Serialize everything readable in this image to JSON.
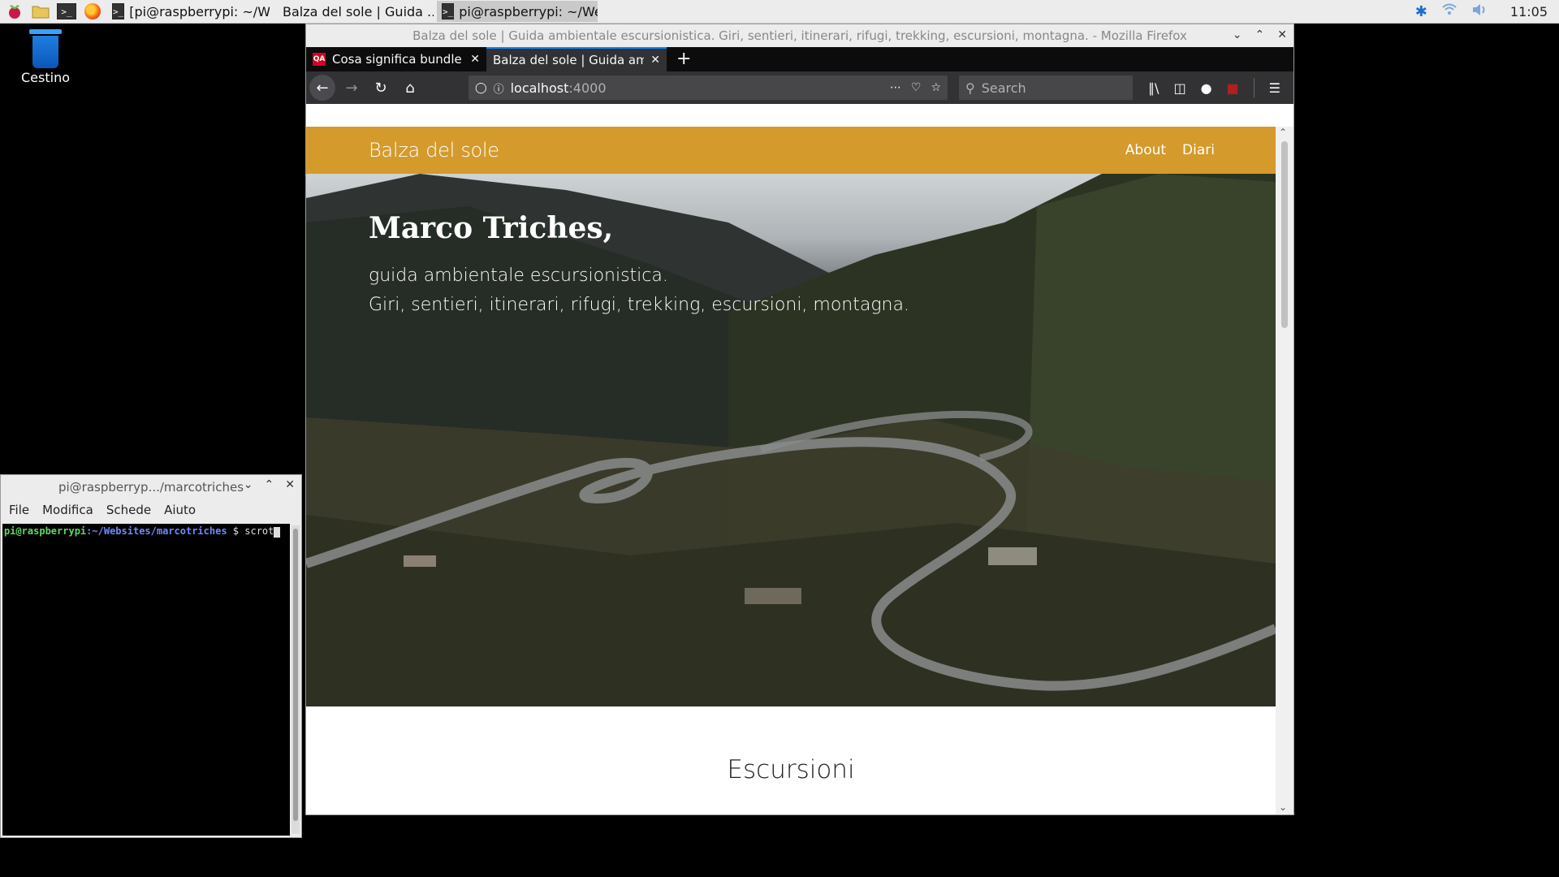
{
  "taskbar": {
    "tasks": [
      {
        "label": "[pi@raspberrypi: ~/We..."
      },
      {
        "label": "Balza del sole | Guida ..."
      },
      {
        "label": "pi@raspberrypi: ~/We..."
      }
    ],
    "clock": "11:05"
  },
  "desktop": {
    "trash_label": "Cestino"
  },
  "terminal": {
    "title": "pi@raspberryp.../marcotriches",
    "menu": [
      "File",
      "Modifica",
      "Schede",
      "Aiuto"
    ],
    "prompt_user": "pi@raspberrypi",
    "prompt_sep": ":",
    "prompt_path": "~/Websites/marcotriches",
    "prompt_symbol": " $ ",
    "command": "scrot"
  },
  "firefox": {
    "window_title": "Balza del sole | Guida ambientale escursionistica. Giri, sentieri, itinerari, rifugi, trekking, escursioni, montagna. - Mozilla Firefox",
    "tabs": [
      {
        "label": "Cosa significa bundle e",
        "icon": "QA"
      },
      {
        "label": "Balza del sole | Guida amb"
      }
    ],
    "url_host": "localhost",
    "url_port": ":4000",
    "search_placeholder": "Search"
  },
  "site": {
    "brand": "Balza del sole",
    "nav": [
      "About",
      "Diari"
    ],
    "hero_title": "Marco Triches,",
    "hero_line1": "guida ambientale escursionistica.",
    "hero_line2": "Giri, sentieri, itinerari, rifugi, trekking, escursioni, montagna.",
    "section_title": "Escursioni",
    "colors": {
      "nav_bg": "#d49a2c"
    }
  }
}
